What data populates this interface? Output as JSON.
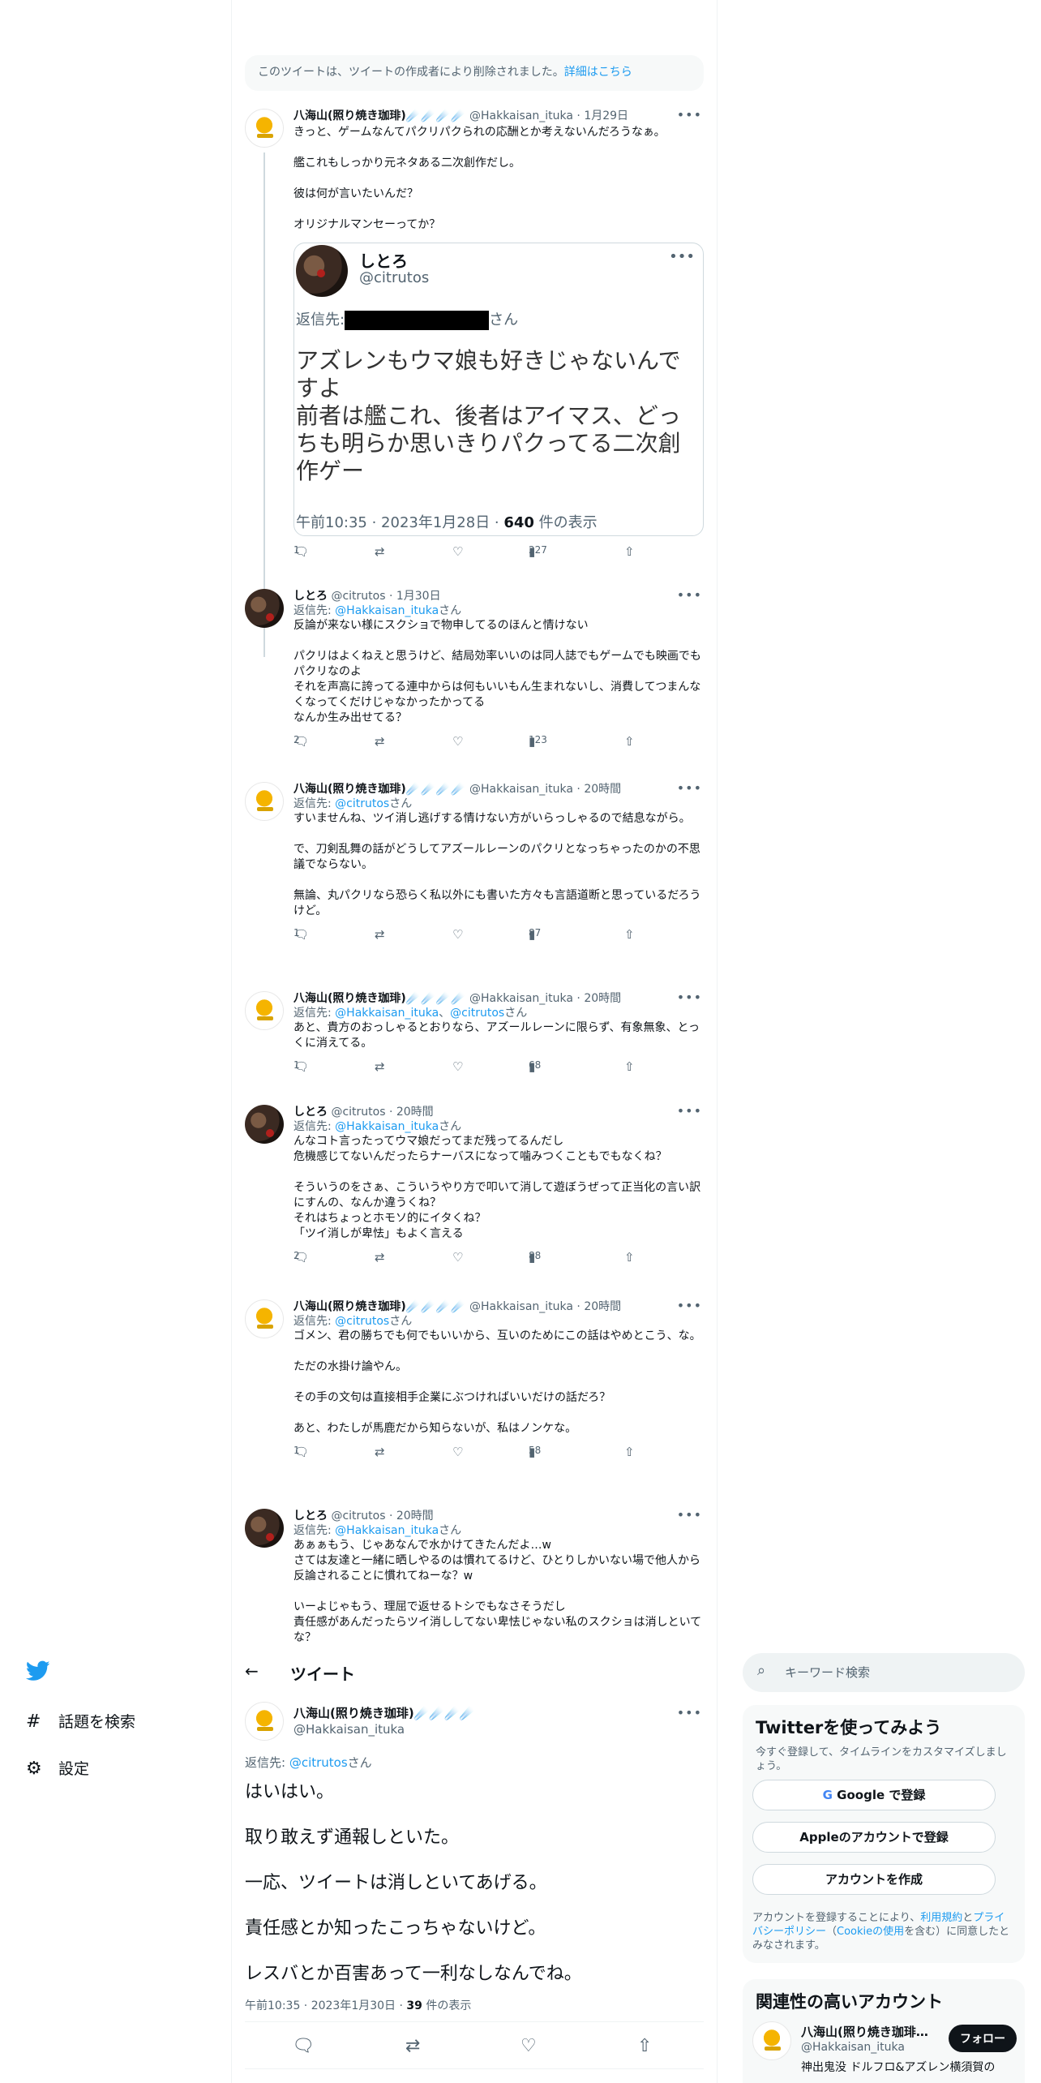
{
  "deleted_notice": {
    "text": "このツイートは、ツイートの作成者により削除されました。",
    "link": "詳細はこちら"
  },
  "more_glyph": "•••",
  "tweets": [
    {
      "name": "八海山(照り焼き珈琲)",
      "badges": "☄️☄️☄️☄️",
      "handle": "@Hakkaisan_ituka",
      "time": "· 1月29日",
      "reply_prefix": "",
      "reply_to": [],
      "reply_suffix": "",
      "text": "きっと、ゲームなんてパクリパクられの応酬とか考えないんだろうなぁ。\n\n艦これもしっかり元ネタある二次創作だし。\n\n彼は何が言いたいんだ？\n\nオリジナルマンセーってか？",
      "counts": {
        "reply": "1",
        "retweet": "",
        "like": "",
        "views": "227"
      }
    },
    {
      "name": "しとろ",
      "badges": "",
      "handle": "@citrutos",
      "time": "· 1月30日",
      "reply_prefix": "返信先: ",
      "reply_to": [
        "@Hakkaisan_ituka"
      ],
      "reply_suffix": "さん",
      "text": "反論が来ない様にスクショで物申してるのほんと情けない\n\nパクリはよくねえと思うけど、結局効率いいのは同人誌でもゲームでも映画でもパクリなのよ\nそれを声高に誇ってる連中からは何もいいもん生まれないし、消費してつまんなくなってくだけじゃなかったかってる\nなんか生み出せてる？",
      "counts": {
        "reply": "2",
        "retweet": "",
        "like": "",
        "views": "123"
      }
    },
    {
      "name": "八海山(照り焼き珈琲)",
      "badges": "☄️☄️☄️☄️",
      "handle": "@Hakkaisan_ituka",
      "time": "· 20時間",
      "reply_prefix": "返信先: ",
      "reply_to": [
        "@citrutos"
      ],
      "reply_suffix": "さん",
      "text": "すいませんね、ツイ消し逃げする情けない方がいらっしゃるので結息ながら。\n\nで、刀剣乱舞の話がどうしてアズールレーンのパクリとなっちゃったのかの不思議でならない。\n\n無論、丸パクリなら恐らく私以外にも書いた方々も言語道断と思っているだろうけど。",
      "counts": {
        "reply": "1",
        "retweet": "",
        "like": "",
        "views": "87"
      }
    },
    {
      "name": "八海山(照り焼き珈琲)",
      "badges": "☄️☄️☄️☄️",
      "handle": "@Hakkaisan_ituka",
      "time": "· 20時間",
      "reply_prefix": "返信先: ",
      "reply_to": [
        "@Hakkaisan_ituka",
        "@citrutos"
      ],
      "reply_suffix": "さん",
      "text": "あと、貴方のおっしゃるとおりなら、アズールレーンに限らず、有象無象、とっくに消えてる。",
      "counts": {
        "reply": "1",
        "retweet": "",
        "like": "",
        "views": "68"
      }
    },
    {
      "name": "しとろ",
      "badges": "",
      "handle": "@citrutos",
      "time": "· 20時間",
      "reply_prefix": "返信先: ",
      "reply_to": [
        "@Hakkaisan_ituka"
      ],
      "reply_suffix": "さん",
      "text": "んなコト言ったってウマ娘だってまだ残ってるんだし\n危機感じてないんだったらナーバスになって噛みつくこともでもなくね？\n\nそういうのをさぁ、こういうやり方で叩いて消して遊ぼうぜって正当化の言い訳にすんの、なんか違うくね？\nそれはちょっとホモソ的にイタくね？\n「ツイ消しが卑怯」もよく言える",
      "counts": {
        "reply": "2",
        "retweet": "",
        "like": "",
        "views": "88"
      }
    },
    {
      "name": "八海山(照り焼き珈琲)",
      "badges": "☄️☄️☄️☄️",
      "handle": "@Hakkaisan_ituka",
      "time": "· 20時間",
      "reply_prefix": "返信先: ",
      "reply_to": [
        "@citrutos"
      ],
      "reply_suffix": "さん",
      "text": "ゴメン、君の勝ちでも何でもいいから、互いのためにこの話はやめとこう、な。\n\nただの水掛け論やん。\n\nその手の文句は直接相手企業にぶつければいいだけの話だろ？\n\nあと、わたしが馬鹿だから知らないが、私はノンケな。",
      "counts": {
        "reply": "1",
        "retweet": "",
        "like": "",
        "views": "58"
      }
    },
    {
      "name": "しとろ",
      "badges": "",
      "handle": "@citrutos",
      "time": "· 20時間",
      "reply_prefix": "返信先: ",
      "reply_to": [
        "@Hakkaisan_ituka"
      ],
      "reply_suffix": "さん",
      "text": "あぁぁもう、じゃあなんで水かけてきたんだよ…w\nさては友達と一緒に晒しやるのは慣れてるけど、ひとりしかいない場で他人から反論されることに慣れてねーな？w\n\nいーよじゃもう、理屈で返せるトシでもなさそうだし\n責任感があんだったらツイ消ししてない卑怯じゃない私のスクショは消しといてな？",
      "counts": {
        "reply": "",
        "retweet": "",
        "like": "",
        "views": ""
      }
    }
  ],
  "quote": {
    "name": "しとろ",
    "handle": "@citrutos",
    "reply_prefix": "返信先:",
    "reply_suffix": "さん",
    "text": "アズレンもウマ娘も好きじゃないんですよ\n前者は艦これ、後者はアイマス、どっちも明らか思いきりパクってる二次創作ゲー",
    "meta_prefix": "午前10:35 · 2023年1月28日 · ",
    "meta_views": "640",
    "meta_suffix": " 件の表示"
  },
  "nav": {
    "search_label": "話題を検索",
    "settings_label": "設定"
  },
  "topbar": {
    "back": "←",
    "title": "ツイート"
  },
  "search": {
    "placeholder": "キーワード検索"
  },
  "main_tweet": {
    "name": "八海山(照り焼き珈琲)",
    "badges": "☄️☄️☄️☄️",
    "handle": "@Hakkaisan_ituka",
    "reply_prefix": "返信先: ",
    "reply_to": "@citrutos",
    "reply_suffix": "さん",
    "paragraphs": [
      "はいはい。",
      "取り敢えず通報しといた。",
      "一応、ツイートは消しといてあげる。",
      "責任感とか知ったこっちゃないけど。",
      "レスバとか百害あって一利なしなんでね。"
    ],
    "meta_prefix": "午前10:35 · 2023年1月30日 · ",
    "meta_views": "39",
    "meta_suffix": " 件の表示"
  },
  "signup": {
    "title": "Twitterを使ってみよう",
    "subtitle": "今すぐ登録して、タイムラインをカスタマイズしましょう。",
    "google": "Google で登録",
    "apple": "Appleのアカウントで登録",
    "create": "アカウントを作成",
    "fine_1": "アカウントを登録することにより、",
    "fine_terms": "利用規約",
    "fine_2": "と",
    "fine_privacy": "プライバシーポリシー",
    "fine_3": "（",
    "fine_cookie": "Cookieの使用",
    "fine_4": "を含む）に同意したとみなされます。"
  },
  "related": {
    "title": "関連性の高いアカウント",
    "name": "八海山(照り焼き珈琲…",
    "handle": "@Hakkaisan_ituka",
    "bio": "神出鬼没 ドルフロ&アズレン横須賀の",
    "follow": "フォロー"
  },
  "colors": {
    "accent": "#1d9bf0",
    "text": "#0f1419",
    "secondary": "#536471"
  }
}
